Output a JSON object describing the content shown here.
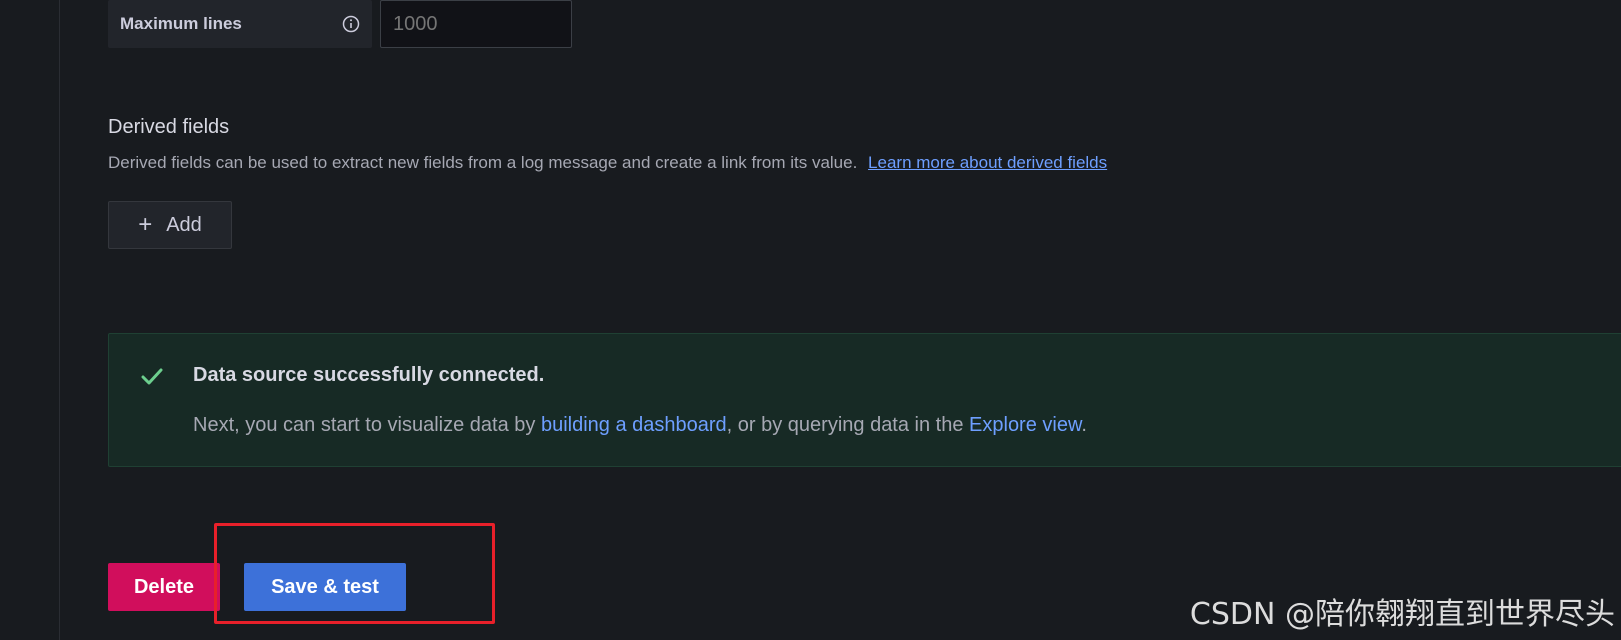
{
  "max_lines": {
    "label": "Maximum lines",
    "value": "1000",
    "info_icon": "info-circle-icon"
  },
  "derived_fields": {
    "title": "Derived fields",
    "description": "Derived fields can be used to extract new fields from a log message and create a link from its value.",
    "link_text": "Learn more about derived fields",
    "add_label": "Add",
    "add_icon": "plus-icon"
  },
  "alert": {
    "icon": "check-icon",
    "title": "Data source successfully connected.",
    "body_pre": "Next, you can start to visualize data by ",
    "link1": "building a dashboard",
    "body_mid": ", or by querying data in the ",
    "link2": "Explore view",
    "body_post": "."
  },
  "actions": {
    "delete_label": "Delete",
    "save_label": "Save & test"
  },
  "watermark": "CSDN @陪你翱翔直到世界尽头",
  "colors": {
    "background": "#181b1f",
    "link": "#6e9fff",
    "success": "#6ccf8e",
    "delete": "#d10e5c",
    "primary": "#3d71d9",
    "highlight": "#e8202a"
  }
}
